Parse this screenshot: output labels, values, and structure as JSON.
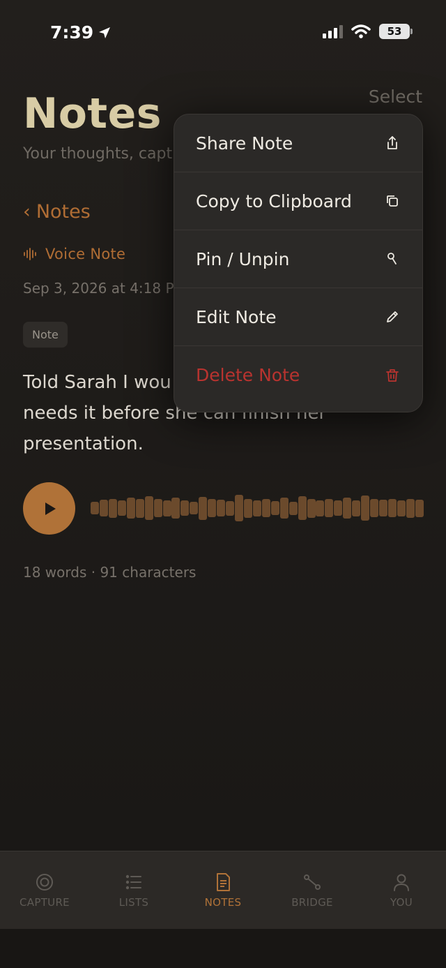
{
  "status_bar": {
    "time": "7:39",
    "battery": "53"
  },
  "header": {
    "select_label": "Select",
    "title": "Notes",
    "subtitle": "Your thoughts, captu"
  },
  "note": {
    "back_label": "Notes",
    "type_label": "Voice Note",
    "date": "Sep 3, 2026 at 4:18 PM",
    "tag": "Note",
    "body_line1": "Told Sarah I wou",
    "body_line2": "needs it before she can finish her",
    "body_line3": "presentation.",
    "stats": "18 words · 91 characters"
  },
  "waveform_levels": [
    0.42,
    0.55,
    0.62,
    0.5,
    0.68,
    0.62,
    0.78,
    0.6,
    0.52,
    0.68,
    0.5,
    0.42,
    0.75,
    0.6,
    0.54,
    0.48,
    0.86,
    0.62,
    0.52,
    0.58,
    0.46,
    0.68,
    0.44,
    0.78,
    0.62,
    0.52,
    0.6,
    0.5,
    0.68,
    0.52,
    0.82,
    0.58,
    0.54,
    0.6,
    0.52,
    0.62,
    0.56
  ],
  "context_menu": {
    "items": [
      {
        "label": "Share Note",
        "icon": "share-icon"
      },
      {
        "label": "Copy to Clipboard",
        "icon": "copy-icon"
      },
      {
        "label": "Pin / Unpin",
        "icon": "pin-icon"
      },
      {
        "label": "Edit Note",
        "icon": "pencil-icon"
      },
      {
        "label": "Delete Note",
        "icon": "trash-icon"
      }
    ]
  },
  "tab_bar": {
    "tabs": [
      {
        "label": "CAPTURE",
        "icon": "capture-icon"
      },
      {
        "label": "LISTS",
        "icon": "list-icon"
      },
      {
        "label": "NOTES",
        "icon": "note-icon"
      },
      {
        "label": "BRIDGE",
        "icon": "bridge-icon"
      },
      {
        "label": "YOU",
        "icon": "person-icon"
      }
    ],
    "active": "NOTES"
  },
  "colors": {
    "accent": "#b07238",
    "title": "#d8cca5",
    "danger": "#b9332f",
    "background": "#1c1917"
  }
}
